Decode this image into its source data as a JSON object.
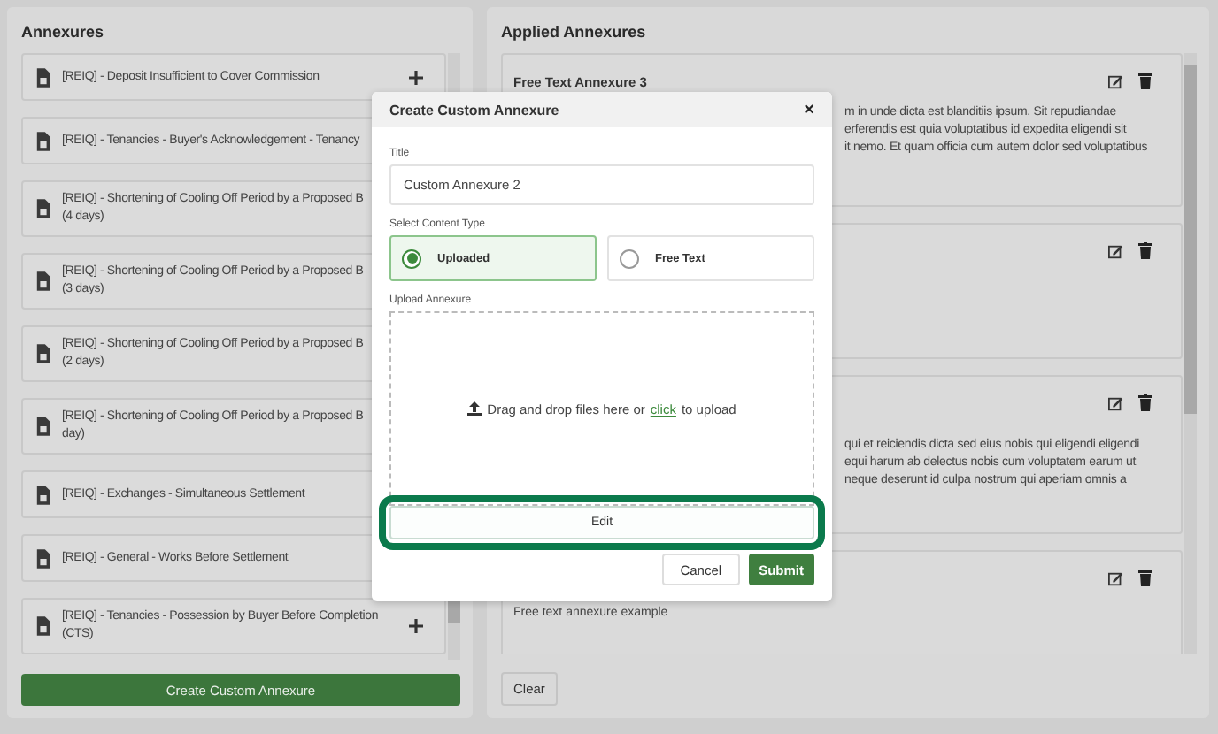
{
  "annexures": {
    "title": "Annexures",
    "items": [
      {
        "lines": [
          "[REIQ] - Deposit Insufficient to Cover Commission"
        ],
        "show_add": true
      },
      {
        "lines": [
          "[REIQ] - Tenancies - Buyer's Acknowledgement - Tenancy"
        ],
        "show_add": false
      },
      {
        "lines": [
          "[REIQ] - Shortening of Cooling Off Period by a Proposed B",
          "(4 days)"
        ],
        "show_add": false
      },
      {
        "lines": [
          "[REIQ] - Shortening of Cooling Off Period by a Proposed B",
          "(3 days)"
        ],
        "show_add": false
      },
      {
        "lines": [
          "[REIQ] - Shortening of Cooling Off Period by a Proposed B",
          "(2 days)"
        ],
        "show_add": false
      },
      {
        "lines": [
          "[REIQ] - Shortening of Cooling Off Period by a Proposed B",
          "day)"
        ],
        "show_add": false
      },
      {
        "lines": [
          "[REIQ] - Exchanges - Simultaneous Settlement"
        ],
        "show_add": false
      },
      {
        "lines": [
          "[REIQ] - General - Works Before Settlement"
        ],
        "show_add": false
      },
      {
        "lines": [
          "[REIQ] - Tenancies - Possession by Buyer Before Completion",
          "(CTS)"
        ],
        "show_add": true
      }
    ],
    "create_button": "Create Custom Annexure"
  },
  "applied": {
    "title": "Applied Annexures",
    "cards": [
      {
        "kind": "free_text",
        "title": "Free Text Annexure 3",
        "lines": [
          "m in unde dicta est blanditiis ipsum. Sit repudiandae",
          "erferendis est quia voluptatibus id expedita eligendi sit",
          "it nemo. Et quam officia cum autem dolor sed voluptatibus"
        ]
      },
      {
        "kind": "free_text"
      },
      {
        "kind": "free_text",
        "lines": [
          "qui et reiciendis dicta sed eius nobis qui eligendi eligendi",
          "equi harum ab delectus nobis cum voluptatem earum ut",
          "neque deserunt id culpa nostrum qui aperiam omnis a"
        ]
      },
      {
        "kind": "free_text",
        "body": "Free text annexure example"
      }
    ],
    "clear_button": "Clear"
  },
  "modal": {
    "title": "Create Custom Annexure",
    "close": "×",
    "title_label": "Title",
    "title_value": "Custom Annexure 2",
    "type_label": "Select Content Type",
    "types": [
      {
        "label": "Uploaded",
        "selected": true
      },
      {
        "label": "Free Text",
        "selected": false
      }
    ],
    "upload_label": "Upload Annexure",
    "drop_text": "Drag and drop files here or",
    "drop_link": "click",
    "drop_tail": "to upload",
    "edit_button": {
      "label": "Edit",
      "highlighted": true
    },
    "cancel_button": "Cancel",
    "submit_button": "Submit"
  }
}
